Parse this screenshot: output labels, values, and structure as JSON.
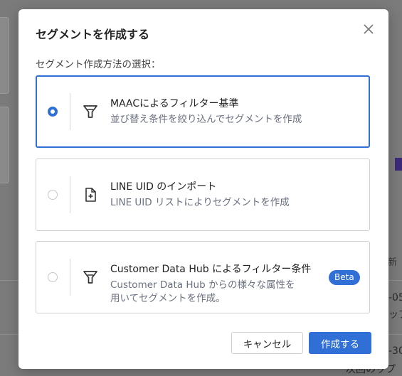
{
  "modal": {
    "title": "セグメントを作成する",
    "section_label": "セグメント作成方法の選択：",
    "options": [
      {
        "title": "MAACによるフィルター基準",
        "description": "並び替え条件を絞り込んでセグメントを作成",
        "icon": "funnel-icon",
        "selected": true
      },
      {
        "title": "LINE UID のインポート",
        "description": "LINE UID リストによりセグメントを作成",
        "icon": "file-plus-icon",
        "selected": false
      },
      {
        "title": "Customer Data Hub によるフィルター条件",
        "description_line1": "Customer Data Hub からの様々な属性を",
        "description_line2": "用いてセグメントを作成。",
        "icon": "funnel-icon",
        "badge": "Beta",
        "selected": false
      }
    ],
    "buttons": {
      "cancel": "キャンセル",
      "create": "作成する"
    }
  },
  "background": {
    "text1": "新",
    "text2": "-05",
    "text3": "ップ",
    "text4": "-30",
    "text5": "次回のップ"
  },
  "colors": {
    "accent": "#2f6fd6",
    "border": "#d0d0d0",
    "description": "#6a7180"
  }
}
